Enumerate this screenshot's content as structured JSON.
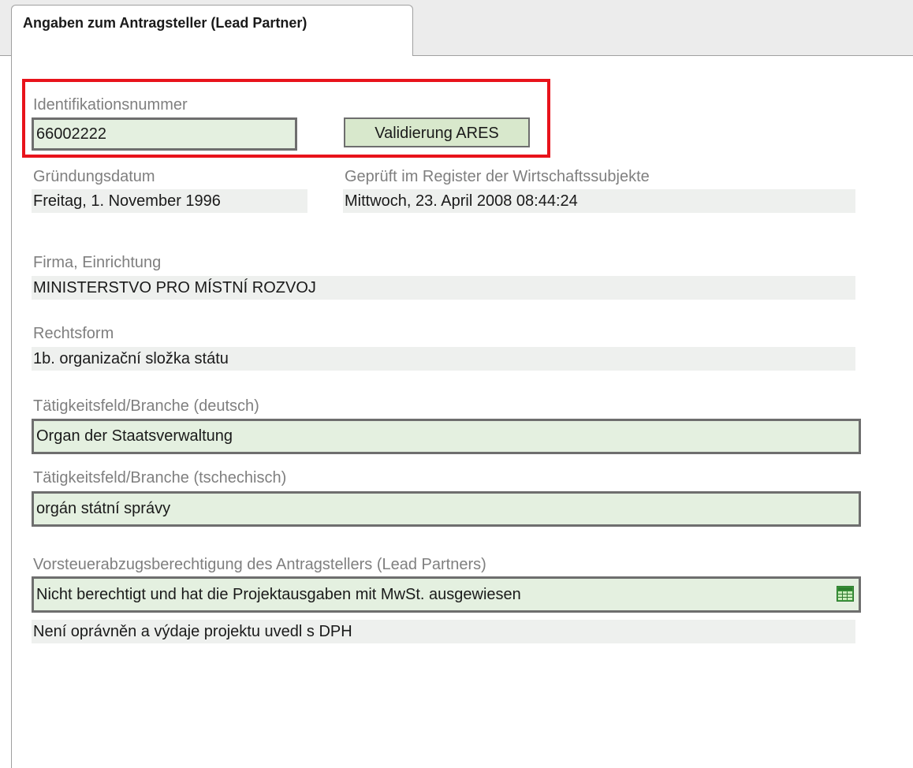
{
  "tab": {
    "label": "Angaben zum Antragsteller (Lead Partner)"
  },
  "identification": {
    "label": "Identifikationsnummer",
    "value": "66002222",
    "validate_button": "Validierung ARES"
  },
  "founding_date": {
    "label": "Gründungsdatum",
    "value": "Freitag, 1. November 1996"
  },
  "register_check": {
    "label": "Geprüft im Register der Wirtschaftssubjekte",
    "value": "Mittwoch, 23. April 2008 08:44:24"
  },
  "company": {
    "label": "Firma, Einrichtung",
    "value": "MINISTERSTVO PRO MÍSTNÍ ROZVOJ"
  },
  "legal_form": {
    "label": "Rechtsform",
    "value": "1b. organizační složka státu"
  },
  "activity_de": {
    "label": "Tätigkeitsfeld/Branche (deutsch)",
    "value": "Organ der Staatsverwaltung"
  },
  "activity_cz": {
    "label": "Tätigkeitsfeld/Branche (tschechisch)",
    "value": "orgán státní správy"
  },
  "vat": {
    "label": "Vorsteuerabzugsberechtigung des Antragstellers (Lead Partners)",
    "selected": "Nicht berechtigt und hat die Projektausgaben mit MwSt. ausgewiesen",
    "translation": "Není oprávněn a výdaje projektu uvedl s DPH",
    "icon": "table-select-icon"
  },
  "colors": {
    "highlight": "#e8131b",
    "input_bg": "#e4f0e0",
    "static_bg": "#eef0ee",
    "label": "#7f7f7f"
  }
}
